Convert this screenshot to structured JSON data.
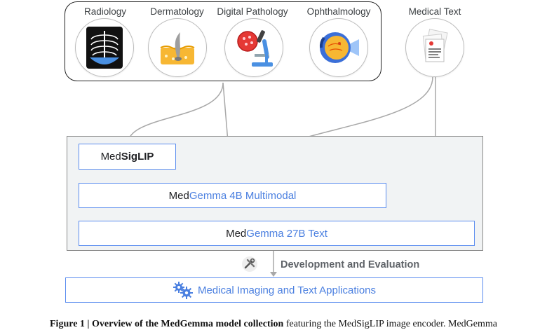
{
  "modalities": [
    {
      "label": "Radiology",
      "icon": "chest-xray-icon"
    },
    {
      "label": "Dermatology",
      "icon": "skin-layers-icon"
    },
    {
      "label": "Digital Pathology",
      "icon": "microscope-icon"
    },
    {
      "label": "Ophthalmology",
      "icon": "eye-icon"
    }
  ],
  "medical_text": {
    "label": "Medical Text",
    "icon": "documents-icon"
  },
  "models": {
    "medsiglip": {
      "prefix": "Med",
      "suffix": "SigLIP"
    },
    "gemma4b": {
      "prefix": "Med",
      "brand": "Gemma",
      "rest": " 4B Multimodal"
    },
    "gemma27b": {
      "prefix": "Med",
      "brand": "Gemma",
      "rest": " 27B Text"
    }
  },
  "development": {
    "label": "Development and Evaluation",
    "icon": "tools-icon"
  },
  "applications": {
    "label": "Medical Imaging and Text Applications",
    "icon": "gears-icon"
  },
  "caption": {
    "lead": "Figure 1 | ",
    "bold": "Overview of the MedGemma model collection",
    "rest": " featuring the MedSigLIP image encoder. MedGemma"
  },
  "colors": {
    "accent": "#4a7fe0",
    "border_blue": "#5b8def",
    "panel": "#f1f3f4"
  }
}
